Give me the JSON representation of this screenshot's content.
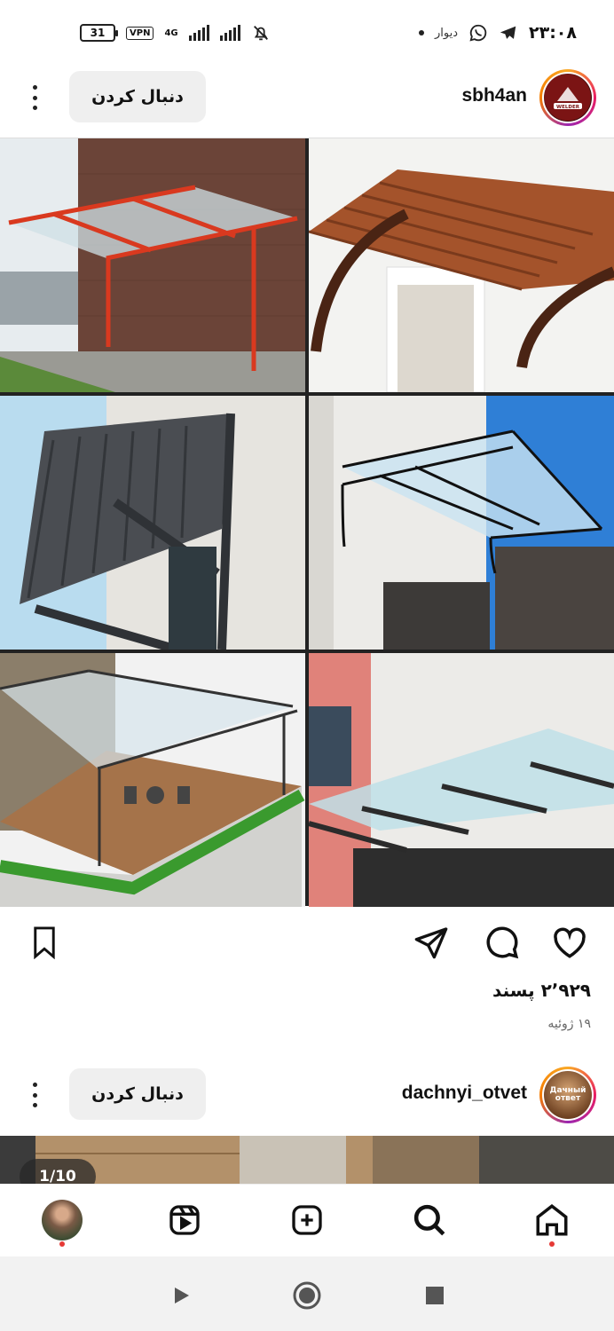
{
  "status_bar": {
    "time": "۲۳:۰۸",
    "app_label": "دیوار",
    "battery": "31",
    "vpn": "VPN",
    "network": "4G"
  },
  "post1": {
    "username": "sbh4an",
    "follow_label": "دنبال کردن",
    "likes": "۲٬۹۲۹ پسند",
    "date": "۱۹ ژوئیه",
    "avatar_text": "WELDER"
  },
  "post2": {
    "username": "dachnyi_otvet",
    "follow_label": "دنبال کردن",
    "avatar_text": "Дачный ответ",
    "counter": "1/10"
  },
  "icons": {
    "more": "more-vertical-icon",
    "like": "heart-icon",
    "comment": "comment-icon",
    "share": "send-icon",
    "save": "bookmark-icon",
    "nav_home": "home-icon",
    "nav_search": "search-icon",
    "nav_create": "plus-square-icon",
    "nav_reels": "reels-icon",
    "nav_profile": "profile-avatar",
    "sys_back": "back-triangle-icon",
    "sys_home": "home-circle-icon",
    "sys_recents": "recents-square-icon"
  },
  "colors": {
    "follow_bg": "#efefef",
    "notification_dot": "#e53935",
    "system_nav_bg": "#f2f2f2"
  }
}
